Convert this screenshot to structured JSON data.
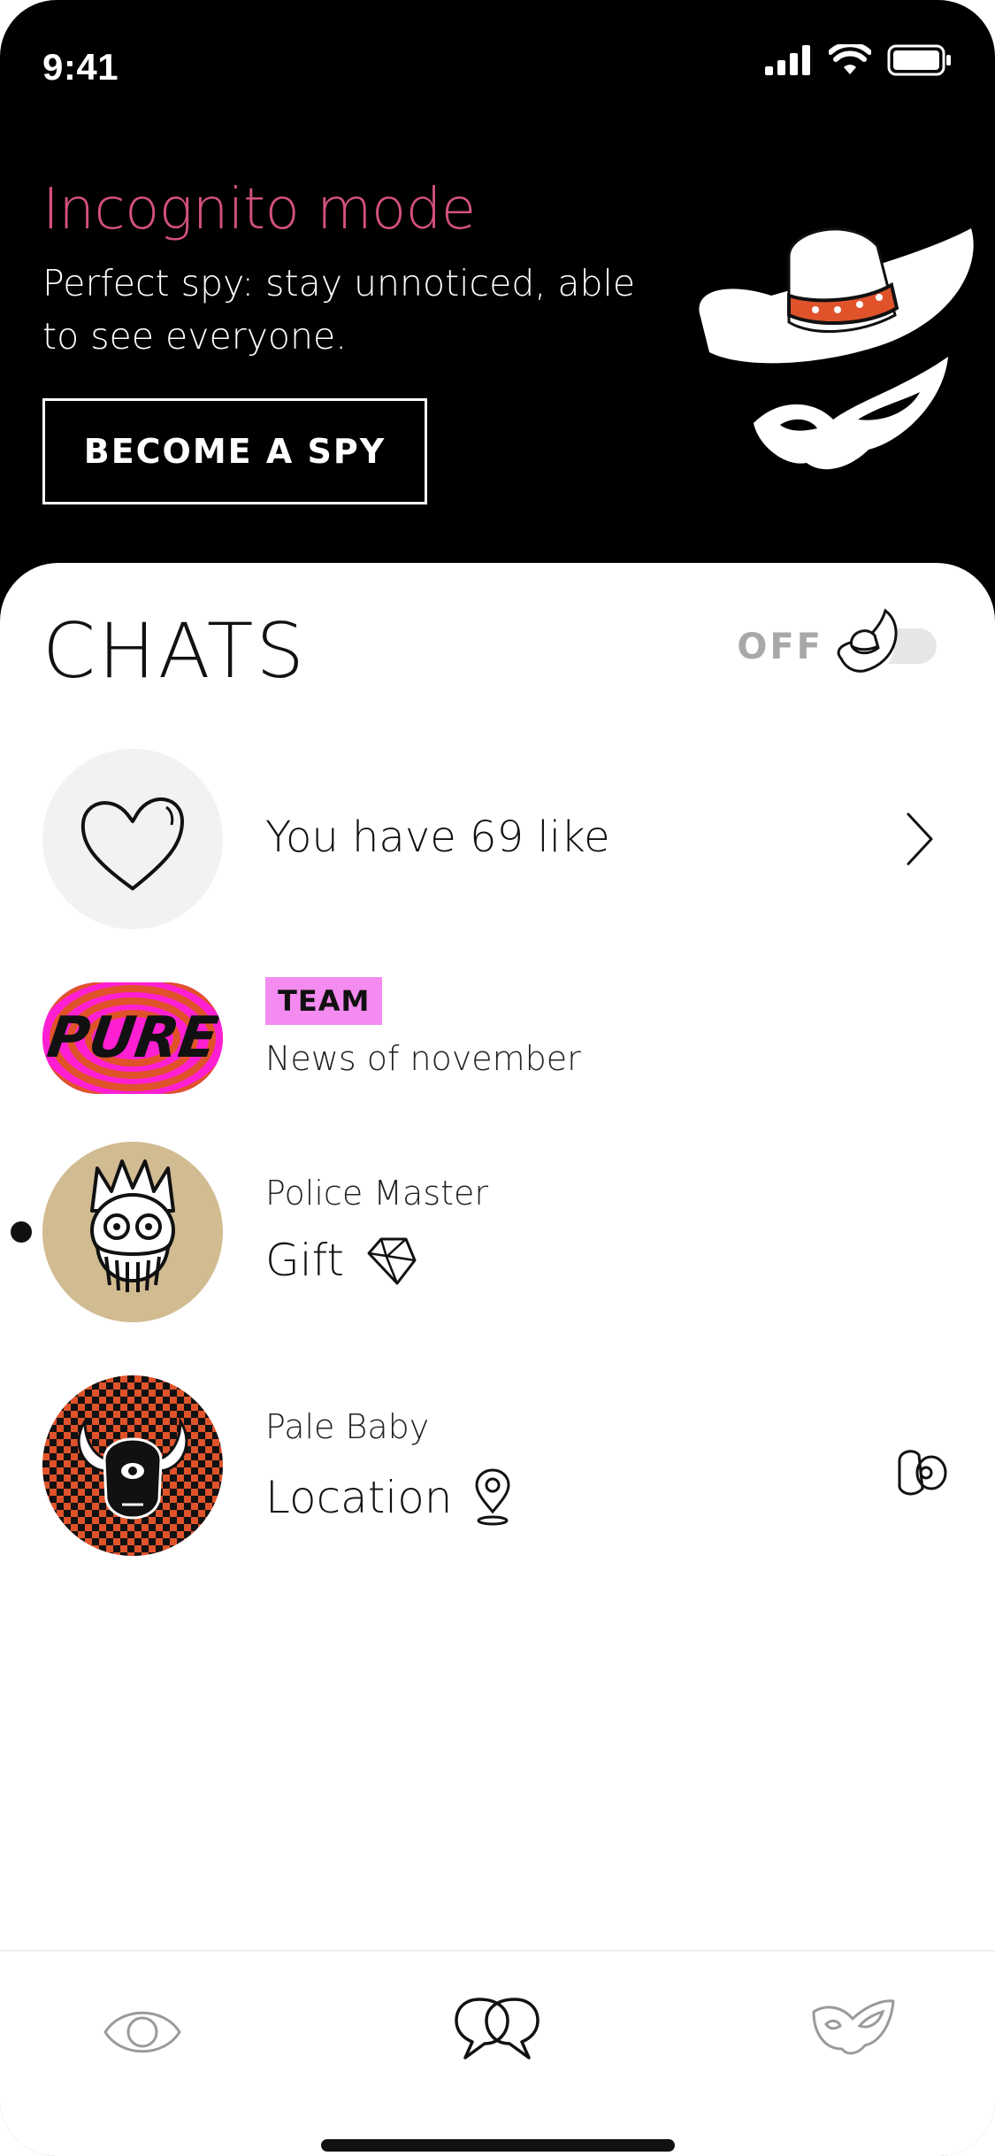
{
  "status_bar": {
    "time": "9:41"
  },
  "promo": {
    "title": "Incognito mode",
    "text": "Perfect spy: stay unnoticed, able to see everyone.",
    "button_label": "BECOME A SPY"
  },
  "chats": {
    "title": "CHATS",
    "spy_toggle": {
      "label": "OFF",
      "enabled": false
    },
    "likes_row": {
      "text": "You have 69 like"
    },
    "items": [
      {
        "badge": "TEAM",
        "message": "News of november",
        "avatar_text": "PURE"
      },
      {
        "name": "Police Master",
        "message": "Gift",
        "unread": true
      },
      {
        "name": "Pale Baby",
        "message": "Location"
      }
    ]
  },
  "colors": {
    "accent": "#d4527a",
    "badge": "#f48bf0",
    "avatar_bg": "#d1bb91",
    "avatar_orange": "#e0532a"
  },
  "icons": [
    "heart-icon",
    "chevron-right-icon",
    "diamond-icon",
    "location-pin-icon",
    "spy-hat-icon",
    "eye-icon",
    "chat-bubbles-icon",
    "mask-icon"
  ]
}
